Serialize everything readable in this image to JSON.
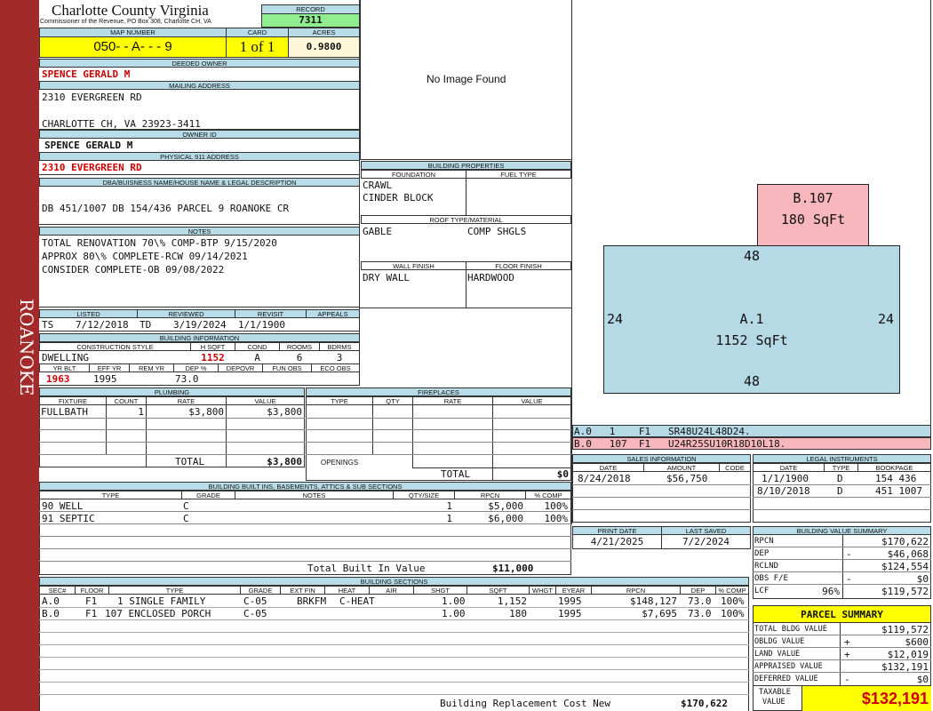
{
  "side_label": "ROANOKE",
  "header": {
    "county": "Charlotte County Virginia",
    "commissioner": "Commissioner of the Revenue, PO Box 308, Charlotte CH, VA",
    "record_label": "RECORD",
    "record": "7311",
    "map_label": "MAP NUMBER",
    "map_number": "050- - A- - - 9",
    "card_label": "CARD",
    "card": "1 of 1",
    "acres_label": "ACRES",
    "acres": "0.9800"
  },
  "owner": {
    "deeded_label": "DEEDED OWNER",
    "deeded": "SPENCE GERALD M",
    "mailing_label": "MAILING ADDRESS",
    "mail1": "2310 EVERGREEN RD",
    "mail2": "CHARLOTTE CH, VA 23923-3411",
    "owner_id_label": "OWNER ID",
    "owner_id": "SPENCE GERALD M",
    "physical_label": "PHYSICAL 911 ADDRESS",
    "physical": "2310 EVERGREEN RD",
    "dba_label": "DBA/BUISNESS NAME/HOUSE NAME & LEGAL DESCRIPTION",
    "legal": "DB 451/1007 DB 154/436 PARCEL 9 ROANOKE CR",
    "notes_label": "NOTES",
    "notes": [
      "TOTAL RENOVATION 70\\% COMP-BTP 9/15/2020",
      "APPROX 80\\% COMPLETE-RCW 09/14/2021",
      "CONSIDER COMPLETE-OB 09/08/2022"
    ]
  },
  "photo": {
    "placeholder": "No Image Found"
  },
  "listing": {
    "listed_label": "LISTED",
    "reviewed_label": "REVIEWED",
    "revisit_label": "REVISIT",
    "appeals_label": "APPEALS",
    "listed_by": "TS",
    "listed": "7/12/2018",
    "reviewed_by": "TD",
    "reviewed": "3/19/2024",
    "revisit": "1/1/1900"
  },
  "building_info": {
    "title": "BUILDING INFORMATION",
    "h_style": "CONSTRUCTION STYLE",
    "h_hsqft": "H SQFT",
    "h_cond": "COND",
    "h_rooms": "ROOMS",
    "h_bdrms": "BDRMS",
    "style": "DWELLING",
    "hsqft": "1152",
    "cond": "A",
    "rooms": "6",
    "bdrms": "3",
    "h_yrblt": "YR BLT",
    "h_effyr": "EFF YR",
    "h_remyr": "REM YR",
    "h_dep": "DEP %",
    "h_depovr": "DEPOVR",
    "h_funobs": "FUN OBS",
    "h_ecoobs": "ECO OBS",
    "yrblt": "1963",
    "effyr": "1995",
    "dep": "73.0"
  },
  "building_props": {
    "title": "BUILDING PROPERTIES",
    "foundation_label": "FOUNDATION",
    "fuel_label": "FUEL TYPE",
    "foundation1": "CRAWL",
    "foundation2": "CINDER BLOCK",
    "roof_label": "ROOF TYPE/MATERIAL",
    "roof_type": "GABLE",
    "roof_mat": "COMP SHGLS",
    "wall_label": "WALL FINISH",
    "floor_label": "FLOOR FINISH",
    "wall": "DRY WALL",
    "floor": "HARDWOOD"
  },
  "sketch": {
    "b_label": "B.107",
    "b_area": "180 SqFt",
    "a_label": "A.1",
    "a_area": "1152 SqFt",
    "top": "48",
    "bottom": "48",
    "left": "24",
    "right": "24",
    "line_a": "A.0   1    F1   SR48U24L48D24.",
    "line_b": "B.0   107  F1   U24R25SU10R18D10L18."
  },
  "plumbing": {
    "title": "PLUMBING",
    "h_fixture": "FIXTURE",
    "h_count": "COUNT",
    "h_rate": "RATE",
    "h_value": "VALUE",
    "fixture": "FULLBATH",
    "count": "1",
    "rate": "$3,800",
    "value": "$3,800",
    "total_label": "TOTAL",
    "total": "$3,800"
  },
  "fireplaces": {
    "title": "FIREPLACES",
    "h_type": "TYPE",
    "h_qty": "QTY",
    "h_rate": "RATE",
    "h_value": "VALUE",
    "openings": "OPENINGS",
    "total_label": "TOTAL",
    "total": "$0"
  },
  "sales": {
    "title": "SALES INFORMATION",
    "h_date": "DATE",
    "h_amount": "AMOUNT",
    "h_code": "CODE",
    "date": "8/24/2018",
    "amount": "$56,750"
  },
  "legal": {
    "title": "LEGAL INSTRUMENTS",
    "h_date": "DATE",
    "h_type": "TYPE",
    "h_book": "BOOKPAGE",
    "rows": [
      {
        "date": "1/1/1900",
        "type": "D",
        "book": "154 436"
      },
      {
        "date": "8/10/2018",
        "type": "D",
        "book": "451 1007"
      }
    ]
  },
  "dates": {
    "print_label": "PRINT DATE",
    "saved_label": "LAST SAVED",
    "print": "4/21/2025",
    "saved": "7/2/2024"
  },
  "builtins": {
    "title": "BUILDING BUILT INS, BASEMENTS, ATTICS & SUB SECTIONS",
    "h_type": "TYPE",
    "h_grade": "GRADE",
    "h_notes": "NOTES",
    "h_qty": "QTY/SIZE",
    "h_rpcn": "RPCN",
    "h_comp": "% COMP",
    "rows": [
      {
        "type": "90 WELL",
        "grade": "C",
        "qty": "1",
        "rpcn": "$5,000",
        "comp": "100%"
      },
      {
        "type": "91 SEPTIC",
        "grade": "C",
        "qty": "1",
        "rpcn": "$6,000",
        "comp": "100%"
      }
    ],
    "total_label": "Total Built In Value",
    "total": "$11,000"
  },
  "bvs": {
    "title": "BUILDING VALUE SUMMARY",
    "rpcn_l": "RPCN",
    "rpcn": "$170,622",
    "dep_l": "DEP",
    "dep_s": "-",
    "dep": "$46,068",
    "rclnd_l": "RCLND",
    "rclnd": "$124,554",
    "obs_l": "OBS F/E",
    "obs_s": "-",
    "obs": "$0",
    "lcf_l": "LCF",
    "lcf_p": "96%",
    "lcf": "$119,572"
  },
  "parcel": {
    "title": "PARCEL SUMMARY",
    "tbv_l": "TOTAL BLDG VALUE",
    "tbv": "$119,572",
    "obldg_l": "OBLDG VALUE",
    "obldg_s": "+",
    "obldg": "$600",
    "land_l": "LAND VALUE",
    "land_s": "+",
    "land": "$12,019",
    "appr_l": "APPRAISED VALUE",
    "appr": "$132,191",
    "def_l": "DEFERRED VALUE",
    "def_s": "-",
    "def": "$0",
    "tax_l1": "TAXABLE",
    "tax_l2": "VALUE",
    "tax": "$132,191"
  },
  "sections": {
    "title": "BUILDING SECTIONS",
    "h": {
      "sec": "SEC#",
      "floor": "FLOOR",
      "type": "TYPE",
      "grade": "GRADE",
      "extfin": "EXT FIN",
      "heat": "HEAT",
      "air": "AIR",
      "shgt": "SHGT",
      "sqft": "SQFT",
      "whgt": "WHGT",
      "eyear": "EYEAR",
      "rpcn": "RPCN",
      "dep": "DEP",
      "comp": "% COMP"
    },
    "rows": [
      {
        "sec": "A.0",
        "floor": "F1",
        "type": "1 SINGLE FAMILY",
        "grade": "C-05",
        "extfin": "BRKFM",
        "heat": "C-HEAT",
        "shgt": "1.00",
        "sqft": "1,152",
        "eyear": "1995",
        "rpcn": "$148,127",
        "dep": "73.0",
        "comp": "100%"
      },
      {
        "sec": "B.0",
        "floor": "F1",
        "type": "107 ENCLOSED PORCH",
        "grade": "C-05",
        "extfin": "",
        "heat": "",
        "shgt": "1.00",
        "sqft": "180",
        "eyear": "1995",
        "rpcn": "$7,695",
        "dep": "73.0",
        "comp": "100%"
      }
    ],
    "brcn_label": "Building Replacement Cost New",
    "brcn": "$170,622"
  }
}
